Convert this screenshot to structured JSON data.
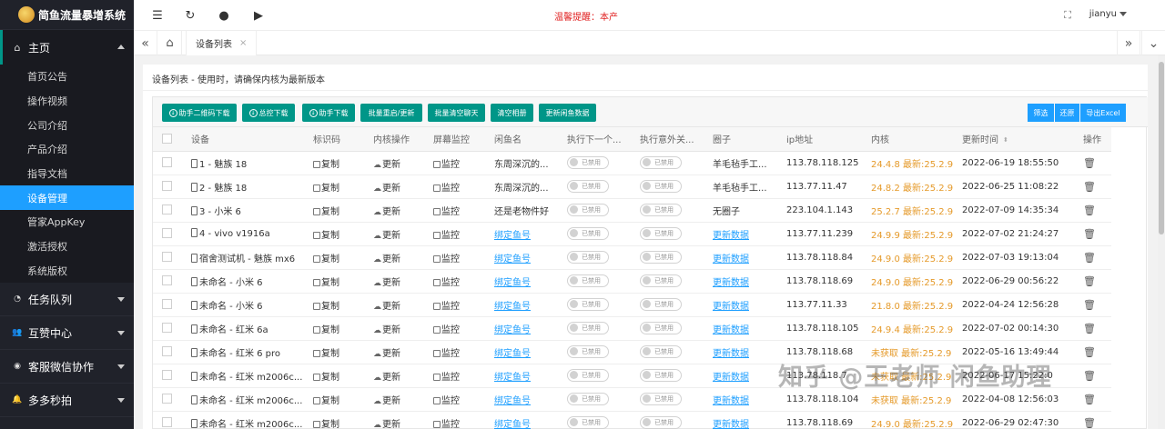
{
  "app": {
    "title": "简鱼流量暴增系统"
  },
  "sidebar": {
    "main_group": "主页",
    "items": [
      {
        "label": "首页公告",
        "selected": false
      },
      {
        "label": "操作视频",
        "selected": false
      },
      {
        "label": "公司介绍",
        "selected": false
      },
      {
        "label": "产品介绍",
        "selected": false
      },
      {
        "label": "指导文档",
        "selected": false
      },
      {
        "label": "设备管理",
        "selected": true
      },
      {
        "label": "管家AppKey",
        "selected": false
      },
      {
        "label": "激活授权",
        "selected": false
      },
      {
        "label": "系统版权",
        "selected": false
      }
    ],
    "groups": [
      {
        "label": "任务队列",
        "icon": "gauge-icon"
      },
      {
        "label": "互赞中心",
        "icon": "users-icon"
      },
      {
        "label": "客服微信协作",
        "icon": "wechat-icon"
      },
      {
        "label": "多多秒拍",
        "icon": "bell-icon"
      }
    ]
  },
  "topbar": {
    "tip": "温馨提醒：本产",
    "user": "jianyu"
  },
  "tabs": [
    {
      "label": "设备列表",
      "close": "×"
    }
  ],
  "card": {
    "title": "设备列表 - 使用时，请确保内核为最新版本"
  },
  "toolbar": {
    "buttons": [
      {
        "label": "助手二维码下载",
        "icon": "download-icon"
      },
      {
        "label": "总控下载",
        "icon": "download-icon"
      },
      {
        "label": "助手下载",
        "icon": "download-icon"
      },
      {
        "label": "批量重启/更新"
      },
      {
        "label": "批量清空聊天"
      },
      {
        "label": "清空相册"
      },
      {
        "label": "更新闲鱼数据"
      }
    ],
    "right_buttons": [
      "筛选",
      "还原",
      "导出Excel"
    ]
  },
  "table": {
    "headers": [
      "设备",
      "标识码",
      "内核操作",
      "屏幕监控",
      "闲鱼名",
      "执行下一个...",
      "执行意外关...",
      "圈子",
      "ip地址",
      "内核",
      "更新时间",
      "操作"
    ],
    "copy_label": "复制",
    "update_label": "更新",
    "monitor_label": "监控",
    "toggle_label": "已禁用",
    "rows": [
      {
        "device": "1 - 魅族 18",
        "xianyu": "东周深沉的...",
        "xianyu_link": false,
        "circle": "羊毛毡手工...",
        "circle_link": false,
        "ip": "113.78.118.125",
        "kernel": "24.4.8 最新:25.2.9",
        "time": "2022-06-19 18:55:50"
      },
      {
        "device": "2 - 魅族 18",
        "xianyu": "东周深沉的...",
        "xianyu_link": false,
        "circle": "羊毛毡手工...",
        "circle_link": false,
        "ip": "113.77.11.47",
        "kernel": "24.8.2 最新:25.2.9",
        "time": "2022-06-25 11:08:22"
      },
      {
        "device": "3 - 小米 6",
        "xianyu": "还是老物件好",
        "xianyu_link": false,
        "circle": "无圈子",
        "circle_link": false,
        "ip": "223.104.1.143",
        "kernel": "25.2.7 最新:25.2.9",
        "time": "2022-07-09 14:35:34"
      },
      {
        "device": "4 - vivo v1916a",
        "xianyu": "绑定鱼号",
        "xianyu_link": true,
        "circle": "更新数据",
        "circle_link": true,
        "ip": "113.77.11.239",
        "kernel": "24.9.9 最新:25.2.9",
        "time": "2022-07-02 21:24:27"
      },
      {
        "device": "宿舍测试机 - 魅族 mx6",
        "xianyu": "绑定鱼号",
        "xianyu_link": true,
        "circle": "更新数据",
        "circle_link": true,
        "ip": "113.78.118.84",
        "kernel": "24.9.0 最新:25.2.9",
        "time": "2022-07-03 19:13:04"
      },
      {
        "device": "未命名 - 小米 6",
        "xianyu": "绑定鱼号",
        "xianyu_link": true,
        "circle": "更新数据",
        "circle_link": true,
        "ip": "113.78.118.69",
        "kernel": "24.9.0 最新:25.2.9",
        "time": "2022-06-29 00:56:22"
      },
      {
        "device": "未命名 - 小米 6",
        "xianyu": "绑定鱼号",
        "xianyu_link": true,
        "circle": "更新数据",
        "circle_link": true,
        "ip": "113.77.11.33",
        "kernel": "21.8.0 最新:25.2.9",
        "time": "2022-04-24 12:56:28"
      },
      {
        "device": "未命名 - 红米 6a",
        "xianyu": "绑定鱼号",
        "xianyu_link": true,
        "circle": "更新数据",
        "circle_link": true,
        "ip": "113.78.118.105",
        "kernel": "24.9.4 最新:25.2.9",
        "time": "2022-07-02 00:14:30"
      },
      {
        "device": "未命名 - 红米 6 pro",
        "xianyu": "绑定鱼号",
        "xianyu_link": true,
        "circle": "更新数据",
        "circle_link": true,
        "ip": "113.78.118.68",
        "kernel": "未获取 最新:25.2.9",
        "time": "2022-05-16 13:49:44"
      },
      {
        "device": "未命名 - 红米 m2006c...",
        "xianyu": "绑定鱼号",
        "xianyu_link": true,
        "circle": "更新数据",
        "circle_link": true,
        "ip": "113.78.118.7",
        "kernel": "未获取 最新:25.2.9",
        "time": "2022-06-17 15:22:0"
      },
      {
        "device": "未命名 - 红米 m2006c...",
        "xianyu": "绑定鱼号",
        "xianyu_link": true,
        "circle": "更新数据",
        "circle_link": true,
        "ip": "113.78.118.104",
        "kernel": "未获取 最新:25.2.9",
        "time": "2022-04-08 12:56:03"
      },
      {
        "device": "未命名 - 红米 m2006c...",
        "xianyu": "绑定鱼号",
        "xianyu_link": true,
        "circle": "更新数据",
        "circle_link": true,
        "ip": "113.78.118.69",
        "kernel": "24.9.0 最新:25.2.9",
        "time": "2022-06-29 02:47:30"
      }
    ]
  },
  "watermark": "知乎 @王老师 闲鱼助理",
  "colors": {
    "sidebar_bg": "#20222a",
    "accent_teal": "#009688",
    "accent_blue": "#1e9fff",
    "warning_orange": "#e59a2a",
    "tip_red": "#e02020"
  }
}
